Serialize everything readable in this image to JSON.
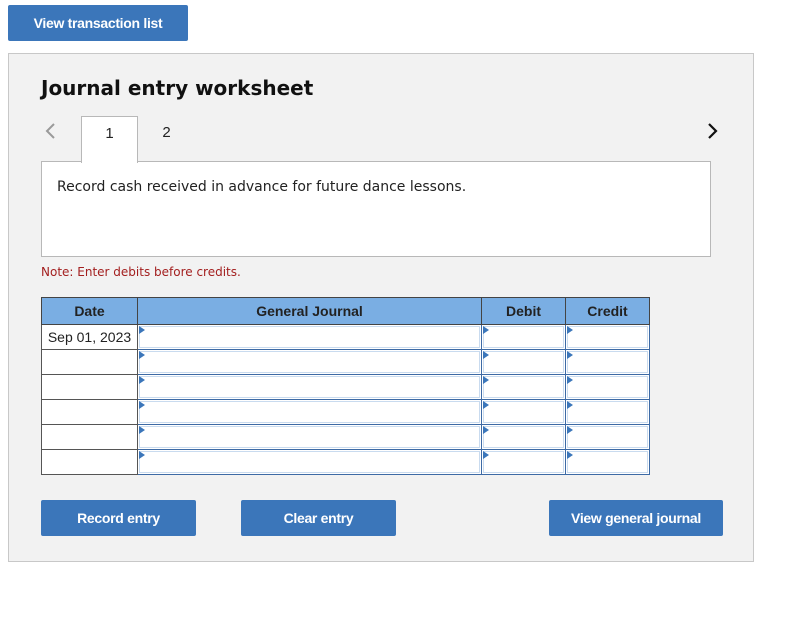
{
  "top_button": {
    "label": "View transaction list"
  },
  "worksheet": {
    "title": "Journal entry worksheet",
    "tabs": [
      {
        "label": "1",
        "active": true
      },
      {
        "label": "2",
        "active": false
      }
    ],
    "nav": {
      "prev_icon": "chevron-left-icon",
      "next_icon": "chevron-right-icon"
    },
    "description": "Record cash received in advance for future dance lessons.",
    "note": "Note: Enter debits before credits.",
    "table": {
      "headers": {
        "date": "Date",
        "general_journal": "General Journal",
        "debit": "Debit",
        "credit": "Credit"
      },
      "rows": [
        {
          "date": "Sep 01, 2023",
          "account": "",
          "debit": "",
          "credit": ""
        },
        {
          "date": "",
          "account": "",
          "debit": "",
          "credit": ""
        },
        {
          "date": "",
          "account": "",
          "debit": "",
          "credit": ""
        },
        {
          "date": "",
          "account": "",
          "debit": "",
          "credit": ""
        },
        {
          "date": "",
          "account": "",
          "debit": "",
          "credit": ""
        },
        {
          "date": "",
          "account": "",
          "debit": "",
          "credit": ""
        }
      ]
    },
    "buttons": {
      "record": "Record entry",
      "clear": "Clear entry",
      "view_journal": "View general journal"
    }
  },
  "colors": {
    "button": "#3b76ba",
    "header": "#7aaee3",
    "note": "#a31f1f"
  }
}
